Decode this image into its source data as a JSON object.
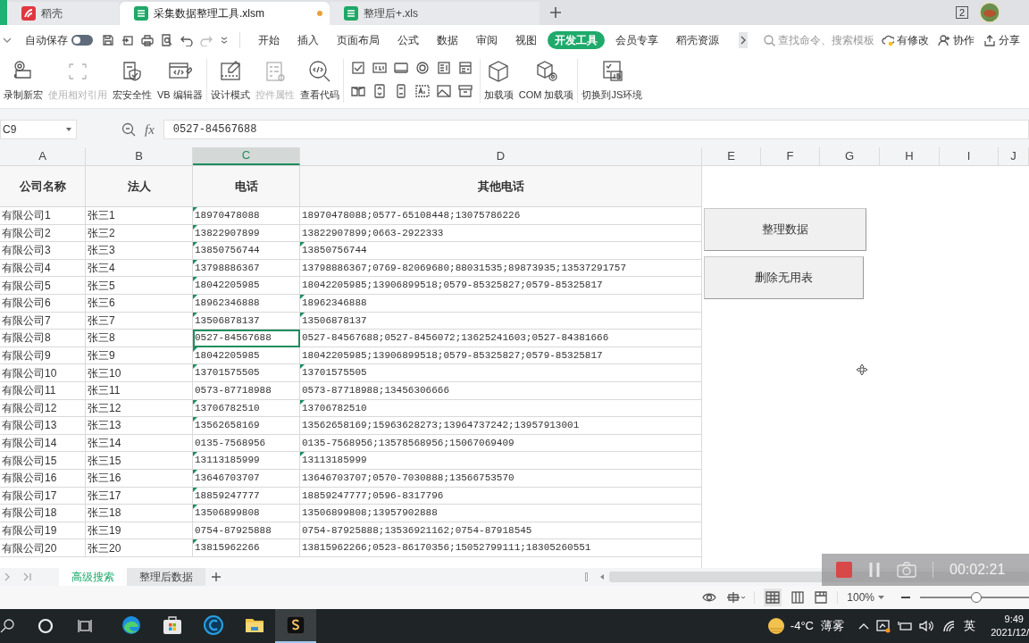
{
  "browser_tabs": [
    {
      "label": "稻壳",
      "kind": "docer",
      "selected": false,
      "unsaved": false
    },
    {
      "label": "采集数据整理工具.xlsm",
      "kind": "sheet",
      "selected": true,
      "unsaved": true
    },
    {
      "label": "整理后+.xls",
      "kind": "sheet",
      "selected": false,
      "unsaved": false
    }
  ],
  "window_count": "2",
  "quick_access": {
    "autosave_label": "自动保存",
    "autosave_on": false
  },
  "ribbon_tabs": [
    {
      "label": "开始",
      "selected": false
    },
    {
      "label": "插入",
      "selected": false
    },
    {
      "label": "页面布局",
      "selected": false
    },
    {
      "label": "公式",
      "selected": false
    },
    {
      "label": "数据",
      "selected": false
    },
    {
      "label": "审阅",
      "selected": false
    },
    {
      "label": "视图",
      "selected": false
    },
    {
      "label": "开发工具",
      "selected": true
    },
    {
      "label": "会员专享",
      "selected": false
    },
    {
      "label": "稻壳资源",
      "selected": false
    }
  ],
  "search": {
    "placeholder": "查找命令、搜索模板"
  },
  "top_actions": [
    {
      "label": "有修改",
      "kind": "cloud"
    },
    {
      "label": "协作",
      "kind": "people"
    },
    {
      "label": "分享",
      "kind": "share"
    }
  ],
  "ribbon_groups": [
    {
      "kind": "buttons",
      "buttons": [
        {
          "label": "录制新宏",
          "kind": "record",
          "disabled": false
        },
        {
          "label": "使用相对引用",
          "kind": "relative",
          "disabled": true
        },
        {
          "label": "宏安全性",
          "kind": "security",
          "disabled": false
        },
        {
          "label": "VB 编辑器",
          "kind": "vb",
          "disabled": false
        }
      ]
    },
    {
      "kind": "buttons",
      "buttons": [
        {
          "label": "设计模式",
          "kind": "design",
          "disabled": false
        },
        {
          "label": "控件属性",
          "kind": "properties",
          "disabled": true
        },
        {
          "label": "查看代码",
          "kind": "code",
          "disabled": false
        }
      ]
    },
    {
      "kind": "controls"
    },
    {
      "kind": "buttons",
      "buttons": [
        {
          "label": "加载项",
          "kind": "addin",
          "disabled": false
        },
        {
          "label": "COM 加载项",
          "kind": "com",
          "disabled": false
        }
      ]
    },
    {
      "kind": "buttons",
      "buttons": [
        {
          "label": "切换到JS环境",
          "kind": "js",
          "disabled": false
        }
      ]
    }
  ],
  "name_box": "C9",
  "function_label": "fx",
  "formula": "0527-84567688",
  "columns": [
    {
      "label": "A",
      "selected": false
    },
    {
      "label": "B",
      "selected": false
    },
    {
      "label": "C",
      "selected": true
    },
    {
      "label": "D",
      "selected": false
    },
    {
      "label": "E",
      "selected": false
    },
    {
      "label": "F",
      "selected": false
    },
    {
      "label": "G",
      "selected": false
    },
    {
      "label": "H",
      "selected": false
    },
    {
      "label": "I",
      "selected": false
    },
    {
      "label": "J",
      "selected": false
    }
  ],
  "headers": [
    "公司名称",
    "法人",
    "电话",
    "其他电话"
  ],
  "rows": [
    {
      "company": "有限公司1",
      "person": "张三1",
      "phone": "18970478088",
      "phone_flag": true,
      "phone_selected": false,
      "other": "18970478088;0577-65108448;13075786226",
      "other_flag": false
    },
    {
      "company": "有限公司2",
      "person": "张三2",
      "phone": "13822907899",
      "phone_flag": true,
      "phone_selected": false,
      "other": "13822907899;0663-2922333",
      "other_flag": false
    },
    {
      "company": "有限公司3",
      "person": "张三3",
      "phone": "13850756744",
      "phone_flag": true,
      "phone_selected": false,
      "other": "13850756744",
      "other_flag": true
    },
    {
      "company": "有限公司4",
      "person": "张三4",
      "phone": "13798886367",
      "phone_flag": true,
      "phone_selected": false,
      "other": "13798886367;0769-82069680;88031535;89873935;13537291757",
      "other_flag": false
    },
    {
      "company": "有限公司5",
      "person": "张三5",
      "phone": "18042205985",
      "phone_flag": true,
      "phone_selected": false,
      "other": "18042205985;13906899518;0579-85325827;0579-85325817",
      "other_flag": false
    },
    {
      "company": "有限公司6",
      "person": "张三6",
      "phone": "18962346888",
      "phone_flag": true,
      "phone_selected": false,
      "other": "18962346888",
      "other_flag": true
    },
    {
      "company": "有限公司7",
      "person": "张三7",
      "phone": "13506878137",
      "phone_flag": true,
      "phone_selected": false,
      "other": "13506878137",
      "other_flag": true
    },
    {
      "company": "有限公司8",
      "person": "张三8",
      "phone": "0527-84567688",
      "phone_flag": false,
      "phone_selected": true,
      "other": "0527-84567688;0527-8456072;13625241603;0527-84381666",
      "other_flag": false
    },
    {
      "company": "有限公司9",
      "person": "张三9",
      "phone": "18042205985",
      "phone_flag": true,
      "phone_selected": false,
      "other": "18042205985;13906899518;0579-85325827;0579-85325817",
      "other_flag": false
    },
    {
      "company": "有限公司10",
      "person": "张三10",
      "phone": "13701575505",
      "phone_flag": true,
      "phone_selected": false,
      "other": "13701575505",
      "other_flag": true
    },
    {
      "company": "有限公司11",
      "person": "张三11",
      "phone": "0573-87718988",
      "phone_flag": false,
      "phone_selected": false,
      "other": "0573-87718988;13456306666",
      "other_flag": false
    },
    {
      "company": "有限公司12",
      "person": "张三12",
      "phone": "13706782510",
      "phone_flag": true,
      "phone_selected": false,
      "other": "13706782510",
      "other_flag": true
    },
    {
      "company": "有限公司13",
      "person": "张三13",
      "phone": "13562658169",
      "phone_flag": true,
      "phone_selected": false,
      "other": "13562658169;15963628273;13964737242;13957913001",
      "other_flag": false
    },
    {
      "company": "有限公司14",
      "person": "张三14",
      "phone": "0135-7568956",
      "phone_flag": false,
      "phone_selected": false,
      "other": "0135-7568956;13578568956;15067069409",
      "other_flag": false
    },
    {
      "company": "有限公司15",
      "person": "张三15",
      "phone": "13113185999",
      "phone_flag": true,
      "phone_selected": false,
      "other": "13113185999",
      "other_flag": true
    },
    {
      "company": "有限公司16",
      "person": "张三16",
      "phone": "13646703707",
      "phone_flag": true,
      "phone_selected": false,
      "other": "13646703707;0570-7030888;13566753570",
      "other_flag": false
    },
    {
      "company": "有限公司17",
      "person": "张三17",
      "phone": "18859247777",
      "phone_flag": true,
      "phone_selected": false,
      "other": "18859247777;0596-8317796",
      "other_flag": false
    },
    {
      "company": "有限公司18",
      "person": "张三18",
      "phone": "13506899808",
      "phone_flag": true,
      "phone_selected": false,
      "other": "13506899808;13957902888",
      "other_flag": false
    },
    {
      "company": "有限公司19",
      "person": "张三19",
      "phone": "0754-87925888",
      "phone_flag": false,
      "phone_selected": false,
      "other": "0754-87925888;13536921162;0754-87918545",
      "other_flag": false
    },
    {
      "company": "有限公司20",
      "person": "张三20",
      "phone": "13815962266",
      "phone_flag": true,
      "phone_selected": false,
      "other": "13815962266;0523-86170356;15052799111;18305260551",
      "other_flag": false
    }
  ],
  "sheet_buttons": [
    "整理数据",
    "删除无用表"
  ],
  "sheet_tabs": [
    {
      "label": "高级搜索",
      "selected": true
    },
    {
      "label": "整理后数据",
      "selected": false
    }
  ],
  "zoom": {
    "label": "100%",
    "level": 0.5
  },
  "recorder": {
    "time": "00:02:21"
  },
  "taskbar": {
    "apps": [
      {
        "kind": "edge",
        "active": false
      },
      {
        "kind": "store",
        "active": false
      },
      {
        "kind": "cleaner",
        "active": false
      },
      {
        "kind": "folder",
        "active": false
      },
      {
        "kind": "wps",
        "active": true
      }
    ],
    "temperature": "-4°C",
    "weather": "薄雾",
    "ime": "英",
    "time": "9:49",
    "date": "2021/12/"
  }
}
